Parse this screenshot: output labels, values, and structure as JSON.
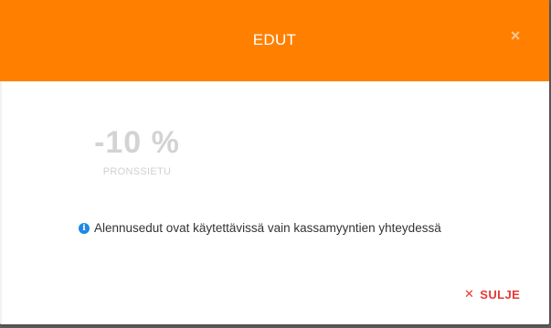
{
  "dialog": {
    "title": "EDUT",
    "close_icon_glyph": "×",
    "close_icon_name": "close-icon",
    "header_color": "#ff8000"
  },
  "benefit": {
    "value": "-10 %",
    "label": "PRONSSIETU"
  },
  "info": {
    "icon_glyph": "i",
    "text": "Alennusedut ovat käytettävissä vain kassamyyntien yhteydessä"
  },
  "footer": {
    "close_icon_glyph": "✕",
    "close_label": "SULJE"
  }
}
